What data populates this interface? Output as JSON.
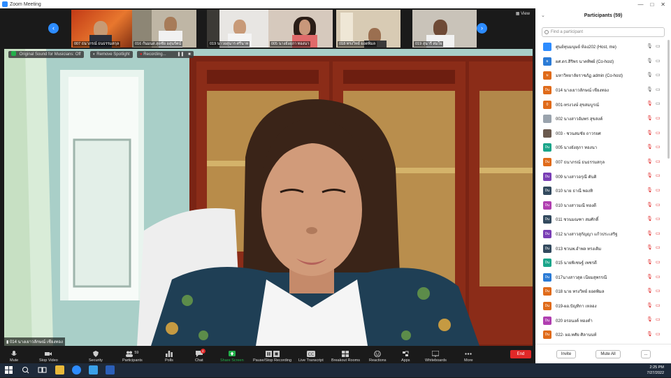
{
  "window": {
    "title": "Zoom Meeting"
  },
  "strip": {
    "view_label": "View",
    "thumbnails": [
      {
        "caption": "007 ธนาภรณ์ ธนธรรมสกุล"
      },
      {
        "caption": "016 กันมนส.สุดชัย อสุนรัตน์"
      },
      {
        "caption": "019 นาวยสุนาร ศรีนาท"
      },
      {
        "caption": "005 นางยังสุภา ทองนา"
      },
      {
        "caption": "018 ทรงวิทย์ ยอดพิมล"
      },
      {
        "caption": "019 สุนารี สมใจ"
      }
    ]
  },
  "video": {
    "chips": {
      "sound": "Original Sound for Musicians: Off",
      "spotlight": "Remove Spotlight",
      "recording": "Recording..."
    },
    "speaker_name": "014 นางเยาวลักษณ์ เชียงทอง"
  },
  "toolbar": {
    "mute": "Mute",
    "stop_video": "Stop Video",
    "security": "Security",
    "participants": "Participants",
    "participants_count": "59",
    "polls": "Polls",
    "chat": "Chat",
    "chat_badge": "2",
    "share_screen": "Share Screen",
    "pause_recording": "Pause/Stop Recording",
    "live_transcript": "Live Transcript",
    "breakout_rooms": "Breakout Rooms",
    "reactions": "Reactions",
    "apps": "Apps",
    "whiteboards": "Whiteboards",
    "more": "More",
    "end": "End"
  },
  "panel": {
    "title": "Participants (59)",
    "search_placeholder": "Find a participant",
    "participants": [
      {
        "initials": "",
        "name": "ศูนย์ทุนมนุษย์ ห้อง202 (Host, me)",
        "color": "#2d8cff",
        "mic": "on",
        "cam": "on"
      },
      {
        "initials": "ผ",
        "name": "ผศ.ดร.สิริพร นาคทิพย์ (Co-host)",
        "color": "#2b7bd6",
        "mic": "on",
        "cam": "on"
      },
      {
        "initials": "ม",
        "name": "มหาวิทยาลัยราชภัฏ admin (Co-host)",
        "color": "#e06b1a",
        "mic": "on",
        "cam": "on"
      },
      {
        "initials": "0น",
        "name": "014 นางเยาวลักษณ์ เชียงทอง",
        "color": "#e06b1a",
        "mic": "on",
        "cam": "on"
      },
      {
        "initials": "0",
        "name": "001-ทรงวงษ์ สุขสมบูรณ์",
        "color": "#e06b1a",
        "mic": "off",
        "cam": "on"
      },
      {
        "initials": "",
        "name": "002 นางสาวอัมพร สุขสงค์",
        "color": "#9aa3ad",
        "mic": "off",
        "cam": "off"
      },
      {
        "initials": "",
        "name": "003 - ชวนสมชัย ถาวรยศ",
        "color": "#6b5a4e",
        "mic": "off",
        "cam": "off"
      },
      {
        "initials": "0น",
        "name": "005 นางยังสุภา ทองนา",
        "color": "#1aa58a",
        "mic": "off",
        "cam": "off"
      },
      {
        "initials": "0น",
        "name": "007 ธนาภรณ์ ธนธรรมสกุล",
        "color": "#e06b1a",
        "mic": "off",
        "cam": "off"
      },
      {
        "initials": "0น",
        "name": "009 นางสาวอรุณี ตันติ",
        "color": "#7a3fb5",
        "mic": "off",
        "cam": "off"
      },
      {
        "initials": "0น",
        "name": "010 นาย ธาณี พองทิ",
        "color": "#334a5e",
        "mic": "off",
        "cam": "off"
      },
      {
        "initials": "0น",
        "name": "010 นางสาวมณี ทองดี",
        "color": "#b03fb0",
        "mic": "off",
        "cam": "off"
      },
      {
        "initials": "0น",
        "name": "011 ชวนมณฑา สมศักดิ์",
        "color": "#334a5e",
        "mic": "off",
        "cam": "off"
      },
      {
        "initials": "0น",
        "name": "012 นางสาวสุกัญญา แก้วประเสริฐ",
        "color": "#7a3fb5",
        "mic": "off",
        "cam": "off"
      },
      {
        "initials": "0น",
        "name": "013 ชวนพ.อำพล ทรงเดิม",
        "color": "#334a5e",
        "mic": "off",
        "cam": "off"
      },
      {
        "initials": "0น",
        "name": "015 นายพิเชษฐ์ เพชรดี",
        "color": "#1aa58a",
        "mic": "off",
        "cam": "off"
      },
      {
        "initials": "0น",
        "name": "017นางสาวสุด เนียมสุพรรณี",
        "color": "#2b7bd6",
        "mic": "off",
        "cam": "off"
      },
      {
        "initials": "0น",
        "name": "018 นาย ทรงวิทย์ ยอดพิมล",
        "color": "#e06b1a",
        "mic": "off",
        "cam": "off"
      },
      {
        "initials": "0น",
        "name": "019-ผอ.ปัญทิกา เหลอง",
        "color": "#e06b1a",
        "mic": "off",
        "cam": "off"
      },
      {
        "initials": "0น",
        "name": "020 อรอนงค์ ทองคำ",
        "color": "#b03fb0",
        "mic": "off",
        "cam": "off"
      },
      {
        "initials": "0น",
        "name": "022- ผอ.ทศัย ศิลานนท์",
        "color": "#e06b1a",
        "mic": "off",
        "cam": "off"
      }
    ],
    "invite_label": "Invite",
    "mute_all_label": "Mute All",
    "more_label": "..."
  },
  "taskbar": {
    "time": "2:25 PM",
    "date": "7/27/2022"
  }
}
